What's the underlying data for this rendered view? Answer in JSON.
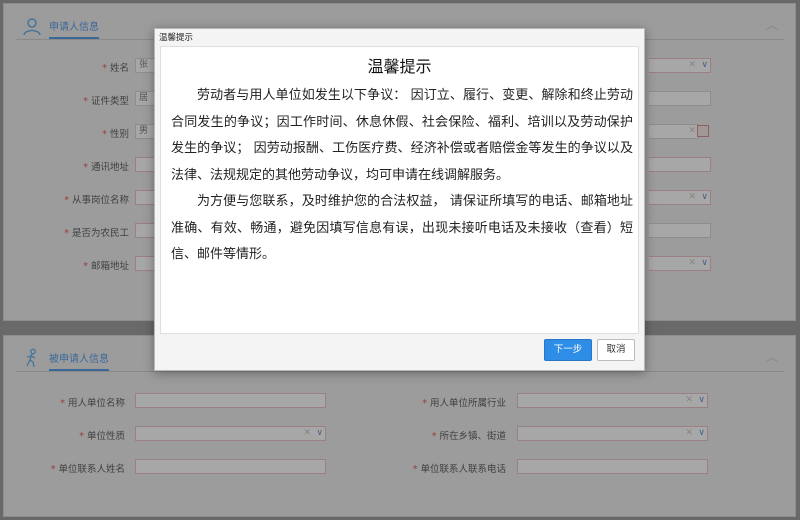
{
  "applicant_section": {
    "title": "申请人信息",
    "collapse_icon": "chevron-up-icon",
    "fields": [
      {
        "label": "姓名",
        "value": "张",
        "kind": "select"
      },
      {
        "label": "证件类型",
        "value": "居",
        "kind": "text"
      },
      {
        "label": "性别",
        "value": "男",
        "kind": "date"
      },
      {
        "label": "通讯地址",
        "value": "",
        "kind": "text"
      },
      {
        "label": "从事岗位名称",
        "value": "",
        "kind": "select"
      },
      {
        "label": "是否为农民工",
        "value": "",
        "kind": "text"
      },
      {
        "label": "邮箱地址",
        "value": "",
        "kind": "select"
      }
    ]
  },
  "respondent_section": {
    "title": "被申请人信息",
    "collapse_icon": "chevron-up-icon",
    "fields_left": [
      {
        "label": "用人单位名称",
        "kind": "text"
      },
      {
        "label": "单位性质",
        "kind": "select"
      },
      {
        "label": "单位联系人姓名",
        "kind": "text"
      }
    ],
    "fields_right": [
      {
        "label": "用人单位所属行业",
        "kind": "select"
      },
      {
        "label": "所在乡镇、街道",
        "kind": "select"
      },
      {
        "label": "单位联系人联系电话",
        "kind": "text"
      }
    ]
  },
  "required_mark": "*",
  "modal": {
    "window_title": "温馨提示",
    "heading": "温馨提示",
    "paragraph_1": "劳动者与用人单位如发生以下争议： 因订立、履行、变更、解除和终止劳动合同发生的争议；因工作时间、休息休假、社会保险、福利、培训以及劳动保护发生的争议； 因劳动报酬、工伤医疗费、经济补偿或者赔偿金等发生的争议以及法律、法规规定的其他劳动争议，均可申请在线调解服务。",
    "paragraph_2": "为方便与您联系，及时维护您的合法权益， 请保证所填写的电话、邮箱地址准确、有效、畅通，避免因填写信息有误，出现未接听电话及未接收（查看）短信、邮件等情形。",
    "next_label": "下一步",
    "cancel_label": "取消"
  },
  "colors": {
    "accent": "#3a8ee6",
    "primary_button": "#2e8de6",
    "required": "#e04040",
    "field_border_required": "#e8b7bf"
  }
}
